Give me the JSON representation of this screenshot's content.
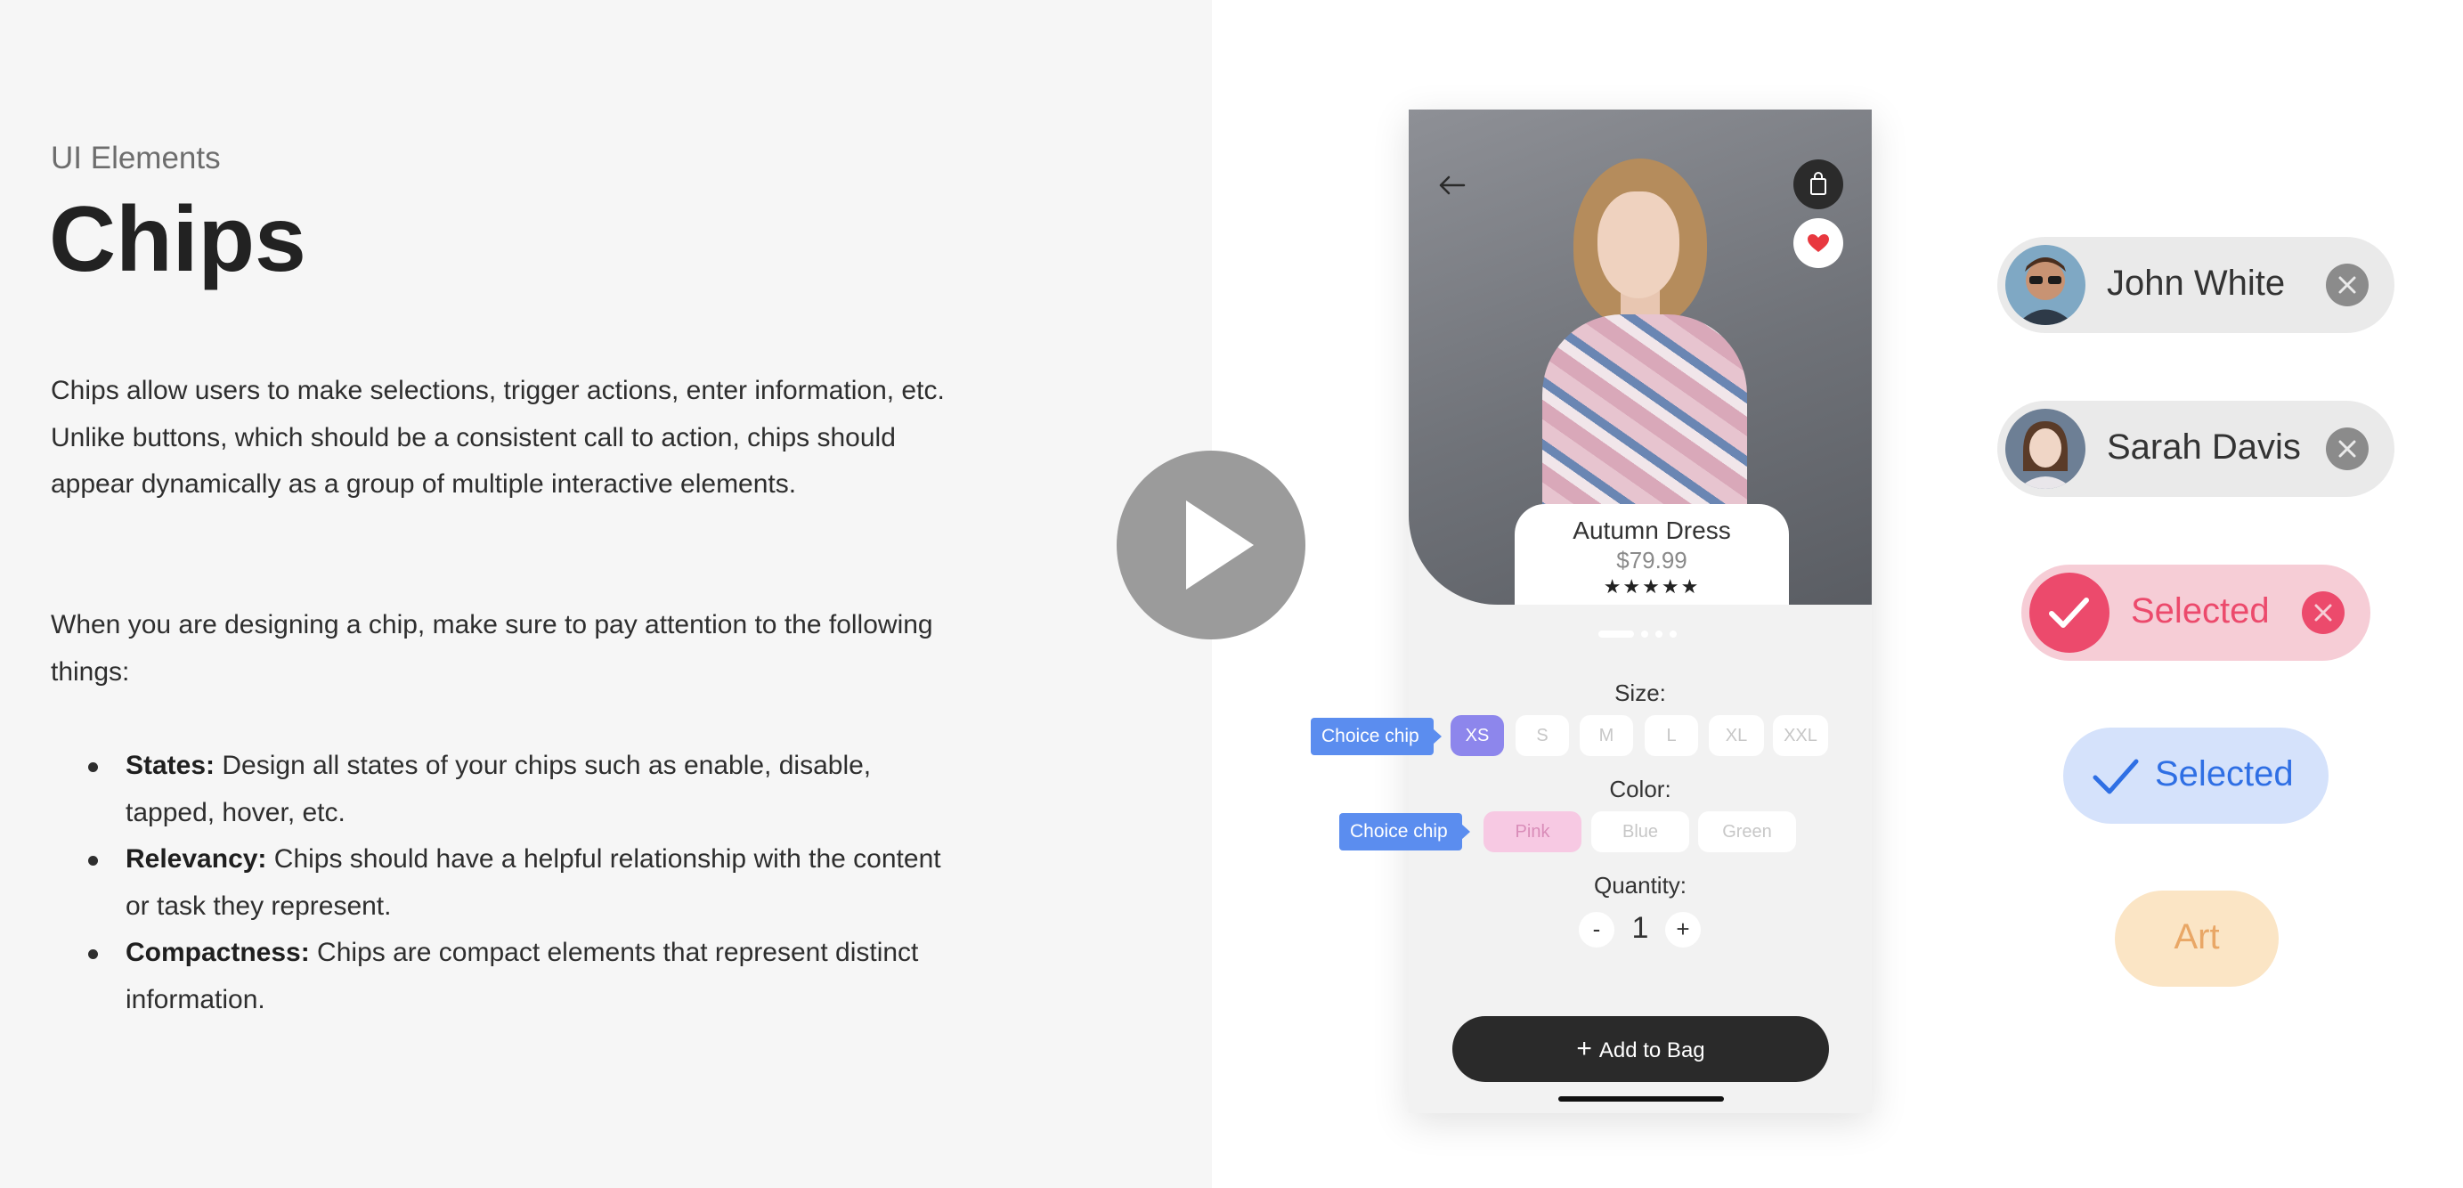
{
  "intro": {
    "eyebrow": "UI Elements",
    "title": "Chips",
    "paragraph1": "Chips allow users to make selections, trigger actions, enter information, etc. Unlike buttons, which should be a consistent call to action, chips should appear dynamically as a group of multiple interactive elements.",
    "paragraph2": "When you are designing a chip, make sure to pay attention to the following things:",
    "bullets": [
      {
        "term": "States:",
        "text": " Design all states of your chips such as enable, disable, tapped, hover, etc."
      },
      {
        "term": "Relevancy:",
        "text": " Chips should have a helpful relationship with the content or task they represent."
      },
      {
        "term": "Compactness:",
        "text": " Chips are compact elements that represent distinct information."
      }
    ]
  },
  "video": {
    "icon": "play-icon"
  },
  "phone": {
    "product": {
      "name": "Autumn Dress",
      "price": "$79.99",
      "stars": "★★★★★",
      "rating": 5
    },
    "size_label": "Size:",
    "sizes": [
      "XS",
      "S",
      "M",
      "L",
      "XL",
      "XXL"
    ],
    "selected_size": "XS",
    "color_label": "Color:",
    "colors": [
      "Pink",
      "Blue",
      "Green"
    ],
    "selected_color": "Pink",
    "quantity_label": "Quantity:",
    "quantity_minus": "-",
    "quantity_plus": "+",
    "quantity": "1",
    "tooltip_size": "Choice chip",
    "tooltip_color": "Choice chip",
    "add_to_bag_icon": "+",
    "add_to_bag": "Add to Bag",
    "icons": {
      "back": "arrow-left-icon",
      "bag": "shopping-bag-icon",
      "favorite": "heart-icon"
    }
  },
  "chips": {
    "input1": {
      "label": "John White",
      "icon": "close-icon"
    },
    "input2": {
      "label": "Sarah Davis",
      "icon": "close-icon"
    },
    "filter_selected": {
      "label": "Selected",
      "color": "#ec4a6c",
      "bg": "#f6cdd6"
    },
    "choice_selected": {
      "label": "Selected",
      "color": "#2f6fe4",
      "bg": "#d5e2fb"
    },
    "suggestion": {
      "label": "Art",
      "color": "#e9a766",
      "bg": "#fbe5c5"
    }
  }
}
